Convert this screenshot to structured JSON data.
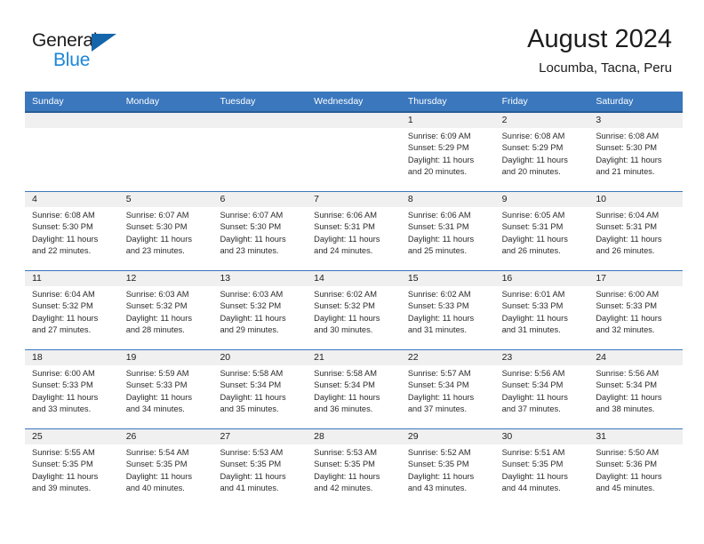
{
  "logo": {
    "word1": "General",
    "word2": "Blue",
    "triangle_color": "#1565aa",
    "word2_color": "#1a86d8"
  },
  "header": {
    "title": "August 2024",
    "subtitle": "Locumba, Tacna, Peru"
  },
  "theme": {
    "header_bg": "#3a77bd",
    "header_rule": "#2b5d96",
    "daynum_bg": "#f0f0f0",
    "row_rule": "#3a77bd",
    "text": "#2b2b2b"
  },
  "weekdays": [
    "Sunday",
    "Monday",
    "Tuesday",
    "Wednesday",
    "Thursday",
    "Friday",
    "Saturday"
  ],
  "labels": {
    "sunrise_prefix": "Sunrise: ",
    "sunset_prefix": "Sunset: ",
    "daylight_prefix": "Daylight: "
  },
  "weeks": [
    [
      {
        "day": ""
      },
      {
        "day": ""
      },
      {
        "day": ""
      },
      {
        "day": ""
      },
      {
        "day": "1",
        "sunrise": "Sunrise: 6:09 AM",
        "sunset": "Sunset: 5:29 PM",
        "daylight1": "Daylight: 11 hours",
        "daylight2": "and 20 minutes."
      },
      {
        "day": "2",
        "sunrise": "Sunrise: 6:08 AM",
        "sunset": "Sunset: 5:29 PM",
        "daylight1": "Daylight: 11 hours",
        "daylight2": "and 20 minutes."
      },
      {
        "day": "3",
        "sunrise": "Sunrise: 6:08 AM",
        "sunset": "Sunset: 5:30 PM",
        "daylight1": "Daylight: 11 hours",
        "daylight2": "and 21 minutes."
      }
    ],
    [
      {
        "day": "4",
        "sunrise": "Sunrise: 6:08 AM",
        "sunset": "Sunset: 5:30 PM",
        "daylight1": "Daylight: 11 hours",
        "daylight2": "and 22 minutes."
      },
      {
        "day": "5",
        "sunrise": "Sunrise: 6:07 AM",
        "sunset": "Sunset: 5:30 PM",
        "daylight1": "Daylight: 11 hours",
        "daylight2": "and 23 minutes."
      },
      {
        "day": "6",
        "sunrise": "Sunrise: 6:07 AM",
        "sunset": "Sunset: 5:30 PM",
        "daylight1": "Daylight: 11 hours",
        "daylight2": "and 23 minutes."
      },
      {
        "day": "7",
        "sunrise": "Sunrise: 6:06 AM",
        "sunset": "Sunset: 5:31 PM",
        "daylight1": "Daylight: 11 hours",
        "daylight2": "and 24 minutes."
      },
      {
        "day": "8",
        "sunrise": "Sunrise: 6:06 AM",
        "sunset": "Sunset: 5:31 PM",
        "daylight1": "Daylight: 11 hours",
        "daylight2": "and 25 minutes."
      },
      {
        "day": "9",
        "sunrise": "Sunrise: 6:05 AM",
        "sunset": "Sunset: 5:31 PM",
        "daylight1": "Daylight: 11 hours",
        "daylight2": "and 26 minutes."
      },
      {
        "day": "10",
        "sunrise": "Sunrise: 6:04 AM",
        "sunset": "Sunset: 5:31 PM",
        "daylight1": "Daylight: 11 hours",
        "daylight2": "and 26 minutes."
      }
    ],
    [
      {
        "day": "11",
        "sunrise": "Sunrise: 6:04 AM",
        "sunset": "Sunset: 5:32 PM",
        "daylight1": "Daylight: 11 hours",
        "daylight2": "and 27 minutes."
      },
      {
        "day": "12",
        "sunrise": "Sunrise: 6:03 AM",
        "sunset": "Sunset: 5:32 PM",
        "daylight1": "Daylight: 11 hours",
        "daylight2": "and 28 minutes."
      },
      {
        "day": "13",
        "sunrise": "Sunrise: 6:03 AM",
        "sunset": "Sunset: 5:32 PM",
        "daylight1": "Daylight: 11 hours",
        "daylight2": "and 29 minutes."
      },
      {
        "day": "14",
        "sunrise": "Sunrise: 6:02 AM",
        "sunset": "Sunset: 5:32 PM",
        "daylight1": "Daylight: 11 hours",
        "daylight2": "and 30 minutes."
      },
      {
        "day": "15",
        "sunrise": "Sunrise: 6:02 AM",
        "sunset": "Sunset: 5:33 PM",
        "daylight1": "Daylight: 11 hours",
        "daylight2": "and 31 minutes."
      },
      {
        "day": "16",
        "sunrise": "Sunrise: 6:01 AM",
        "sunset": "Sunset: 5:33 PM",
        "daylight1": "Daylight: 11 hours",
        "daylight2": "and 31 minutes."
      },
      {
        "day": "17",
        "sunrise": "Sunrise: 6:00 AM",
        "sunset": "Sunset: 5:33 PM",
        "daylight1": "Daylight: 11 hours",
        "daylight2": "and 32 minutes."
      }
    ],
    [
      {
        "day": "18",
        "sunrise": "Sunrise: 6:00 AM",
        "sunset": "Sunset: 5:33 PM",
        "daylight1": "Daylight: 11 hours",
        "daylight2": "and 33 minutes."
      },
      {
        "day": "19",
        "sunrise": "Sunrise: 5:59 AM",
        "sunset": "Sunset: 5:33 PM",
        "daylight1": "Daylight: 11 hours",
        "daylight2": "and 34 minutes."
      },
      {
        "day": "20",
        "sunrise": "Sunrise: 5:58 AM",
        "sunset": "Sunset: 5:34 PM",
        "daylight1": "Daylight: 11 hours",
        "daylight2": "and 35 minutes."
      },
      {
        "day": "21",
        "sunrise": "Sunrise: 5:58 AM",
        "sunset": "Sunset: 5:34 PM",
        "daylight1": "Daylight: 11 hours",
        "daylight2": "and 36 minutes."
      },
      {
        "day": "22",
        "sunrise": "Sunrise: 5:57 AM",
        "sunset": "Sunset: 5:34 PM",
        "daylight1": "Daylight: 11 hours",
        "daylight2": "and 37 minutes."
      },
      {
        "day": "23",
        "sunrise": "Sunrise: 5:56 AM",
        "sunset": "Sunset: 5:34 PM",
        "daylight1": "Daylight: 11 hours",
        "daylight2": "and 37 minutes."
      },
      {
        "day": "24",
        "sunrise": "Sunrise: 5:56 AM",
        "sunset": "Sunset: 5:34 PM",
        "daylight1": "Daylight: 11 hours",
        "daylight2": "and 38 minutes."
      }
    ],
    [
      {
        "day": "25",
        "sunrise": "Sunrise: 5:55 AM",
        "sunset": "Sunset: 5:35 PM",
        "daylight1": "Daylight: 11 hours",
        "daylight2": "and 39 minutes."
      },
      {
        "day": "26",
        "sunrise": "Sunrise: 5:54 AM",
        "sunset": "Sunset: 5:35 PM",
        "daylight1": "Daylight: 11 hours",
        "daylight2": "and 40 minutes."
      },
      {
        "day": "27",
        "sunrise": "Sunrise: 5:53 AM",
        "sunset": "Sunset: 5:35 PM",
        "daylight1": "Daylight: 11 hours",
        "daylight2": "and 41 minutes."
      },
      {
        "day": "28",
        "sunrise": "Sunrise: 5:53 AM",
        "sunset": "Sunset: 5:35 PM",
        "daylight1": "Daylight: 11 hours",
        "daylight2": "and 42 minutes."
      },
      {
        "day": "29",
        "sunrise": "Sunrise: 5:52 AM",
        "sunset": "Sunset: 5:35 PM",
        "daylight1": "Daylight: 11 hours",
        "daylight2": "and 43 minutes."
      },
      {
        "day": "30",
        "sunrise": "Sunrise: 5:51 AM",
        "sunset": "Sunset: 5:35 PM",
        "daylight1": "Daylight: 11 hours",
        "daylight2": "and 44 minutes."
      },
      {
        "day": "31",
        "sunrise": "Sunrise: 5:50 AM",
        "sunset": "Sunset: 5:36 PM",
        "daylight1": "Daylight: 11 hours",
        "daylight2": "and 45 minutes."
      }
    ]
  ]
}
